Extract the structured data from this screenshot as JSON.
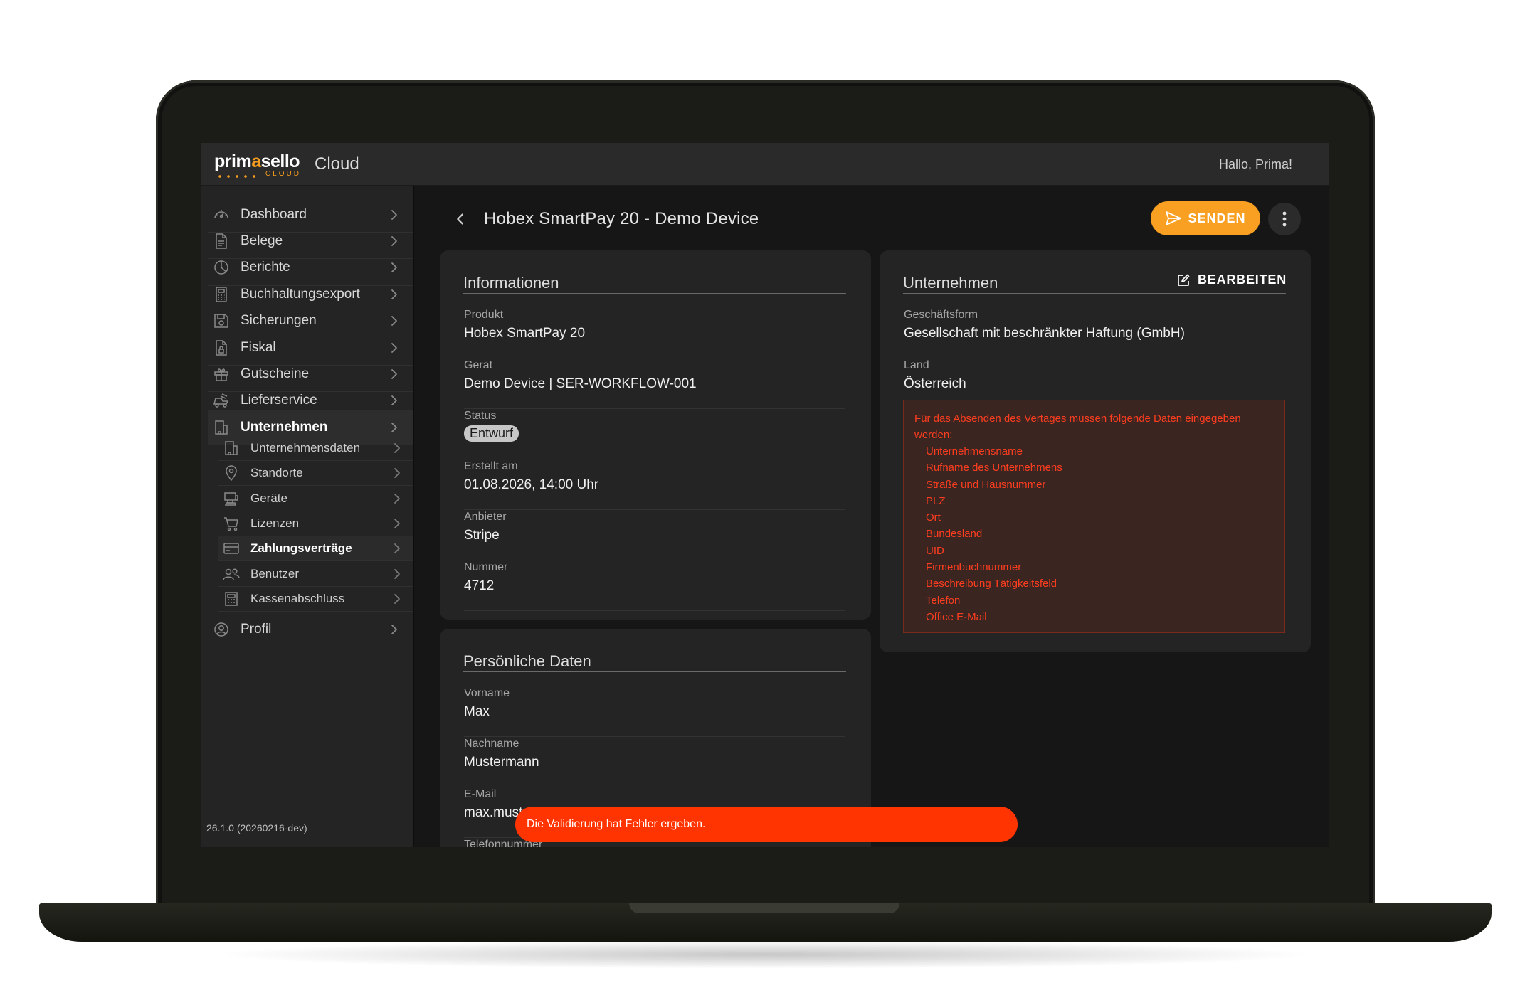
{
  "app": {
    "logo_text_a": "prim",
    "logo_text_b": "a",
    "logo_text_c": "sello",
    "logo_sub": "CLOUD",
    "title": "Cloud",
    "greeting": "Hallo, Prima!",
    "accent_color": "#f9a023"
  },
  "sidebar": {
    "items": [
      {
        "label": "Dashboard",
        "icon": "gauge-icon"
      },
      {
        "label": "Belege",
        "icon": "document-icon"
      },
      {
        "label": "Berichte",
        "icon": "pie-chart-icon"
      },
      {
        "label": "Buchhaltungsexport",
        "icon": "calculator-icon"
      },
      {
        "label": "Sicherungen",
        "icon": "save-icon"
      },
      {
        "label": "Fiskal",
        "icon": "document-lock-icon"
      },
      {
        "label": "Gutscheine",
        "icon": "gift-icon"
      },
      {
        "label": "Lieferservice",
        "icon": "delivery-icon"
      },
      {
        "label": "Unternehmen",
        "icon": "building-icon"
      }
    ],
    "sub_items": [
      {
        "label": "Unternehmensdaten",
        "icon": "building-icon"
      },
      {
        "label": "Standorte",
        "icon": "location-pin-icon"
      },
      {
        "label": "Geräte",
        "icon": "pos-terminal-icon"
      },
      {
        "label": "Lizenzen",
        "icon": "cart-icon"
      },
      {
        "label": "Zahlungsverträge",
        "icon": "credit-card-icon"
      },
      {
        "label": "Benutzer",
        "icon": "users-icon"
      },
      {
        "label": "Kassenabschluss",
        "icon": "register-icon"
      }
    ],
    "profile": {
      "label": "Profil",
      "icon": "user-circle-icon"
    },
    "version": "26.1.0 (20260216-dev)"
  },
  "header": {
    "title": "Hobex SmartPay 20 - Demo Device",
    "send_label": "SENDEN"
  },
  "info_card": {
    "title": "Informationen",
    "fields": [
      {
        "label": "Produkt",
        "value": "Hobex SmartPay 20"
      },
      {
        "label": "Gerät",
        "value": "Demo Device | SER-WORKFLOW-001"
      },
      {
        "label": "Status",
        "value": "Entwurf"
      },
      {
        "label": "Erstellt am",
        "value": "01.08.2026, 14:00 Uhr"
      },
      {
        "label": "Anbieter",
        "value": "Stripe"
      },
      {
        "label": "Nummer",
        "value": "4712"
      }
    ]
  },
  "personal_card": {
    "title": "Persönliche Daten",
    "fields": [
      {
        "label": "Vorname",
        "value": "Max"
      },
      {
        "label": "Nachname",
        "value": "Mustermann"
      },
      {
        "label": "E-Mail",
        "value": "max.must"
      },
      {
        "label": "Telefonnummer",
        "value": ""
      }
    ]
  },
  "company_card": {
    "title": "Unternehmen",
    "edit_label": "BEARBEITEN",
    "fields": [
      {
        "label": "Geschäftsform",
        "value": "Gesellschaft mit beschränkter Haftung (GmbH)"
      },
      {
        "label": "Land",
        "value": "Österreich"
      }
    ],
    "error_message": "Für das Absenden des Vertages müssen folgende Daten eingegeben werden:",
    "missing_fields": [
      "Unternehmensname",
      "Rufname des Unternehmens",
      "Straße und Hausnummer",
      "PLZ",
      "Ort",
      "Bundesland",
      "UID",
      "Firmenbuchnummer",
      "Beschreibung Tätigkeitsfeld",
      "Telefon",
      "Office E-Mail"
    ],
    "error_color": "#ff3d1f"
  },
  "toast": {
    "message": "Die Validierung hat Fehler ergeben.",
    "color": "#ff3400"
  }
}
